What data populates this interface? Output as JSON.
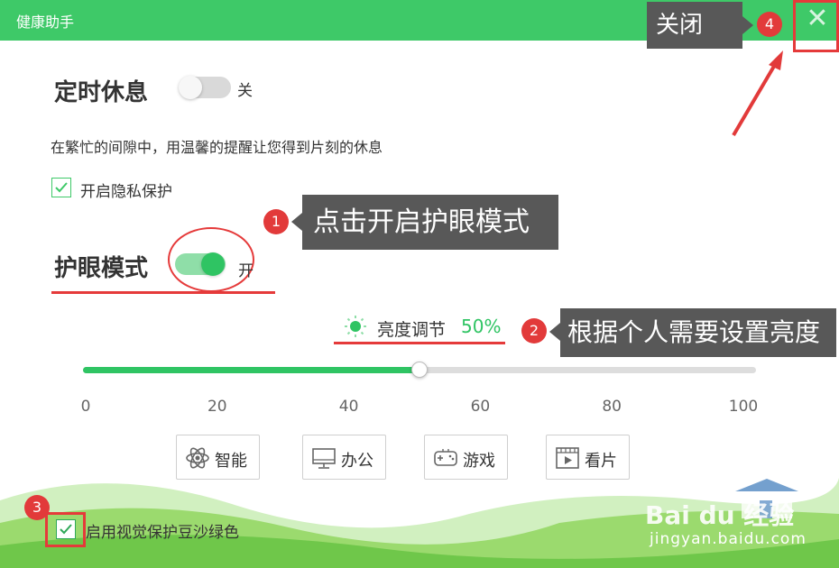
{
  "window": {
    "title": "健康助手",
    "close_glyph": "✕"
  },
  "annotations": {
    "a1": {
      "num": "1",
      "text": "点击开启护眼模式"
    },
    "a2": {
      "num": "2",
      "text": "根据个人需要设置亮度"
    },
    "a3": {
      "num": "3"
    },
    "a4": {
      "num": "4",
      "text": "关闭"
    }
  },
  "rest": {
    "title": "定时休息",
    "toggle_state": "关",
    "enabled": false,
    "description": "在繁忙的间隙中，用温馨的提醒让您得到片刻的休息",
    "privacy_label": "开启隐私保护",
    "privacy_checked": true
  },
  "eye": {
    "title": "护眼模式",
    "toggle_state": "开",
    "enabled": true,
    "brightness_label": "亮度调节",
    "brightness_value": "50%",
    "brightness_fraction": 0.5,
    "ticks": [
      "0",
      "20",
      "40",
      "60",
      "80",
      "100"
    ],
    "modes": [
      {
        "label": "智能",
        "icon": "atom-icon"
      },
      {
        "label": "办公",
        "icon": "monitor-icon"
      },
      {
        "label": "游戏",
        "icon": "gamepad-icon"
      },
      {
        "label": "看片",
        "icon": "film-icon"
      }
    ],
    "green_label": "启用视觉保护豆沙绿色",
    "green_checked": true
  },
  "watermark": {
    "brand": "Bai du 经验",
    "url": "jingyan.baidu.com"
  },
  "colors": {
    "accent": "#3ec968",
    "accent_dark": "#2fc463",
    "annotation_red": "#e23a3a",
    "annotation_box": "#585858"
  }
}
